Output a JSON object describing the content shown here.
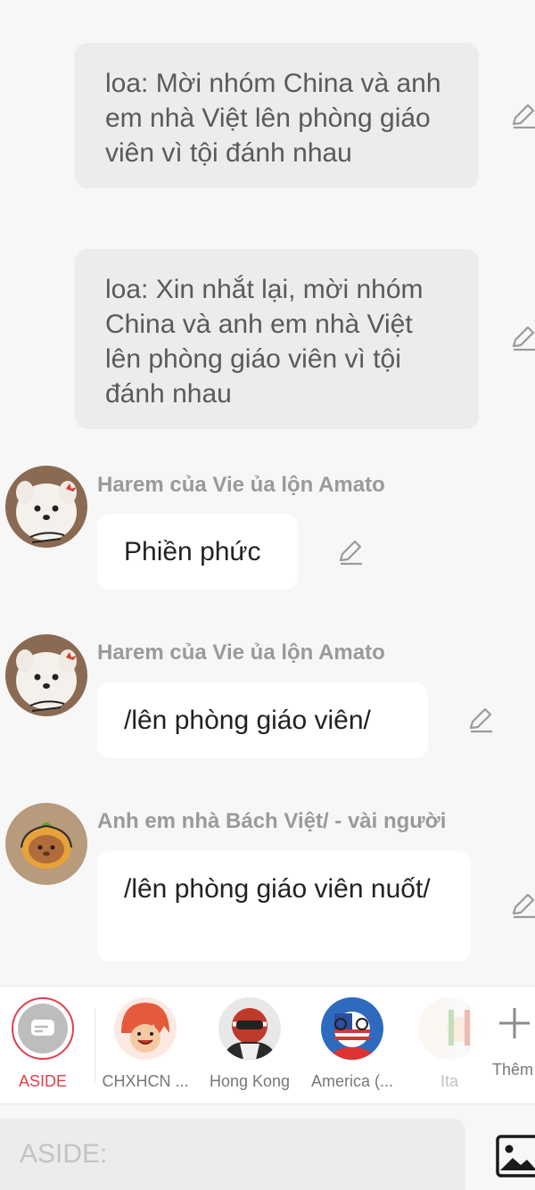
{
  "messages": [
    {
      "type": "narration",
      "text": "loa: Mời nhóm China và anh em nhà Việt lên phòng giáo viên vì tội đánh nhau"
    },
    {
      "type": "narration",
      "text": "loa: Xin nhắt lại, mời nhóm China và anh em nhà Việt lên phòng giáo viên vì tội đánh nhau"
    },
    {
      "type": "chat",
      "sender": "Harem của Vie ủa lộn Amato",
      "text": "Phiền phức",
      "avatar_icon": "white-dog-avatar"
    },
    {
      "type": "chat",
      "sender": "Harem của Vie ủa lộn Amato",
      "text": "/lên phòng giáo viên/",
      "avatar_icon": "white-dog-avatar"
    },
    {
      "type": "chat",
      "sender": "Anh em nhà Bách Việt/ - vài người",
      "text": "/lên phòng giáo viên nuốt/",
      "avatar_icon": "capybara-avatar"
    }
  ],
  "characters": [
    {
      "name": "ASIDE",
      "icon": "chat-bubble-icon",
      "selected": true
    },
    {
      "name": "CHXHCN ...",
      "icon": "red-hair-character-avatar"
    },
    {
      "name": "Hong Kong",
      "icon": "hong-kong-character-avatar"
    },
    {
      "name": "America (...",
      "icon": "america-character-avatar"
    },
    {
      "name": "Ita",
      "icon": "italy-character-avatar"
    }
  ],
  "add_more_label": "Thêm",
  "input": {
    "placeholder": "ASIDE:"
  },
  "colors": {
    "accent": "#e0404a",
    "bubble": "#ffffff",
    "narration_bg": "#ececec",
    "background": "#f7f7f7"
  }
}
